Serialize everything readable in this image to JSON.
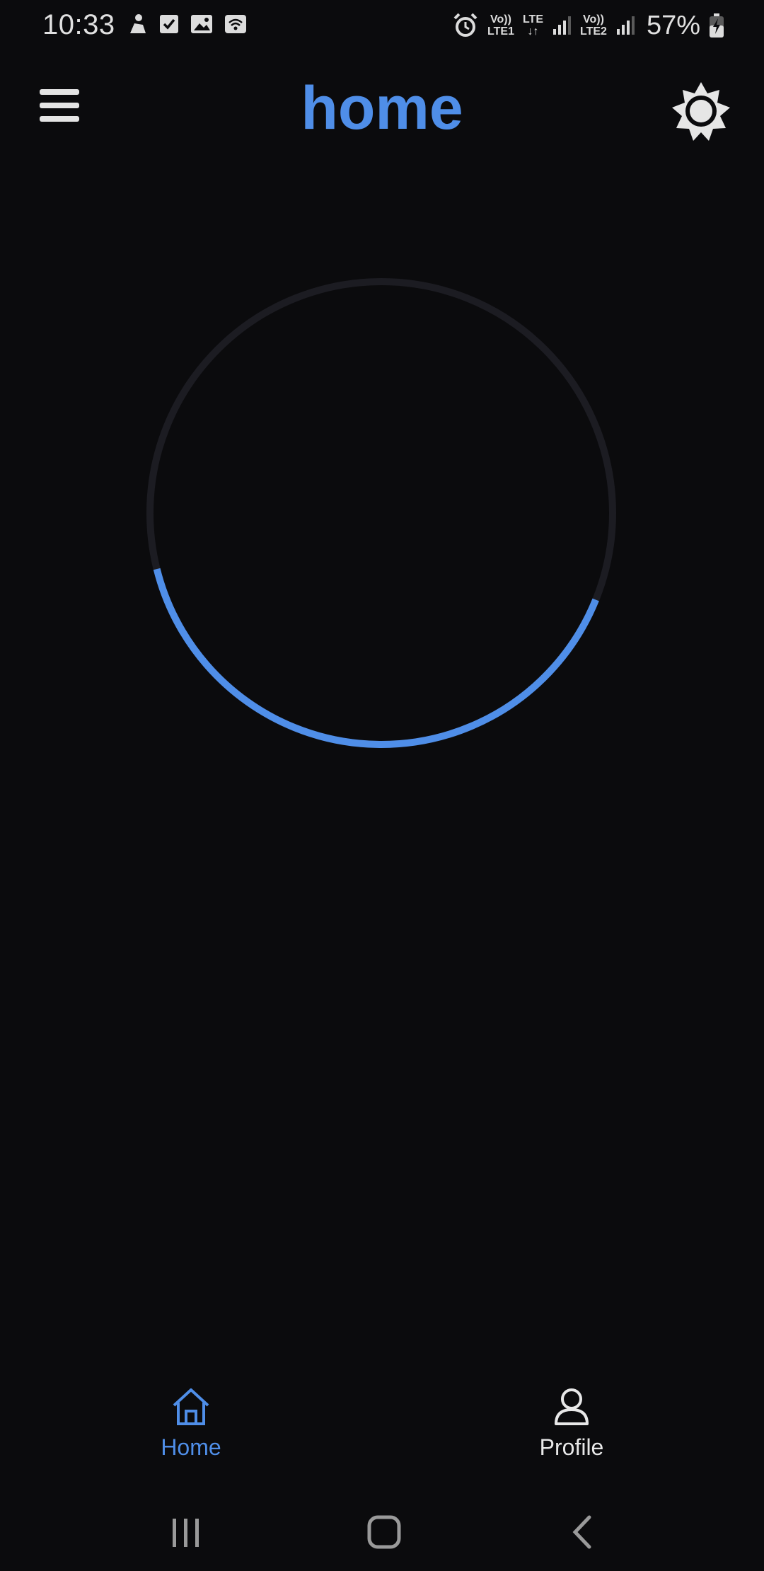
{
  "status_bar": {
    "time": "10:33",
    "left_icons": [
      "notification-app-icon",
      "checkbox-icon",
      "image-icon",
      "wifi-hotspot-icon"
    ],
    "alarm_icon": "alarm-icon",
    "sim1": {
      "top": "Vo))",
      "bottom": "LTE1"
    },
    "lte": {
      "top": "LTE",
      "bottom": "↓↑"
    },
    "sim2": {
      "top": "Vo))",
      "bottom": "LTE2"
    },
    "battery": "57%"
  },
  "header": {
    "menu_icon": "hamburger-menu-icon",
    "title": "home",
    "theme_icon": "sun-theme-icon"
  },
  "progress_ring": {
    "progress": 0.4,
    "track_color": "#1c1c22",
    "progress_color": "#4f8ee8"
  },
  "bottom_nav": {
    "items": [
      {
        "label": "Home",
        "icon": "home-icon",
        "active": true
      },
      {
        "label": "Profile",
        "icon": "profile-icon",
        "active": false
      }
    ]
  },
  "system_nav": {
    "recents_icon": "recents-icon",
    "home_icon": "home-button-icon",
    "back_icon": "back-icon"
  },
  "colors": {
    "background": "#0b0b0d",
    "accent": "#4f8ee8",
    "text": "#e6e6e6"
  }
}
